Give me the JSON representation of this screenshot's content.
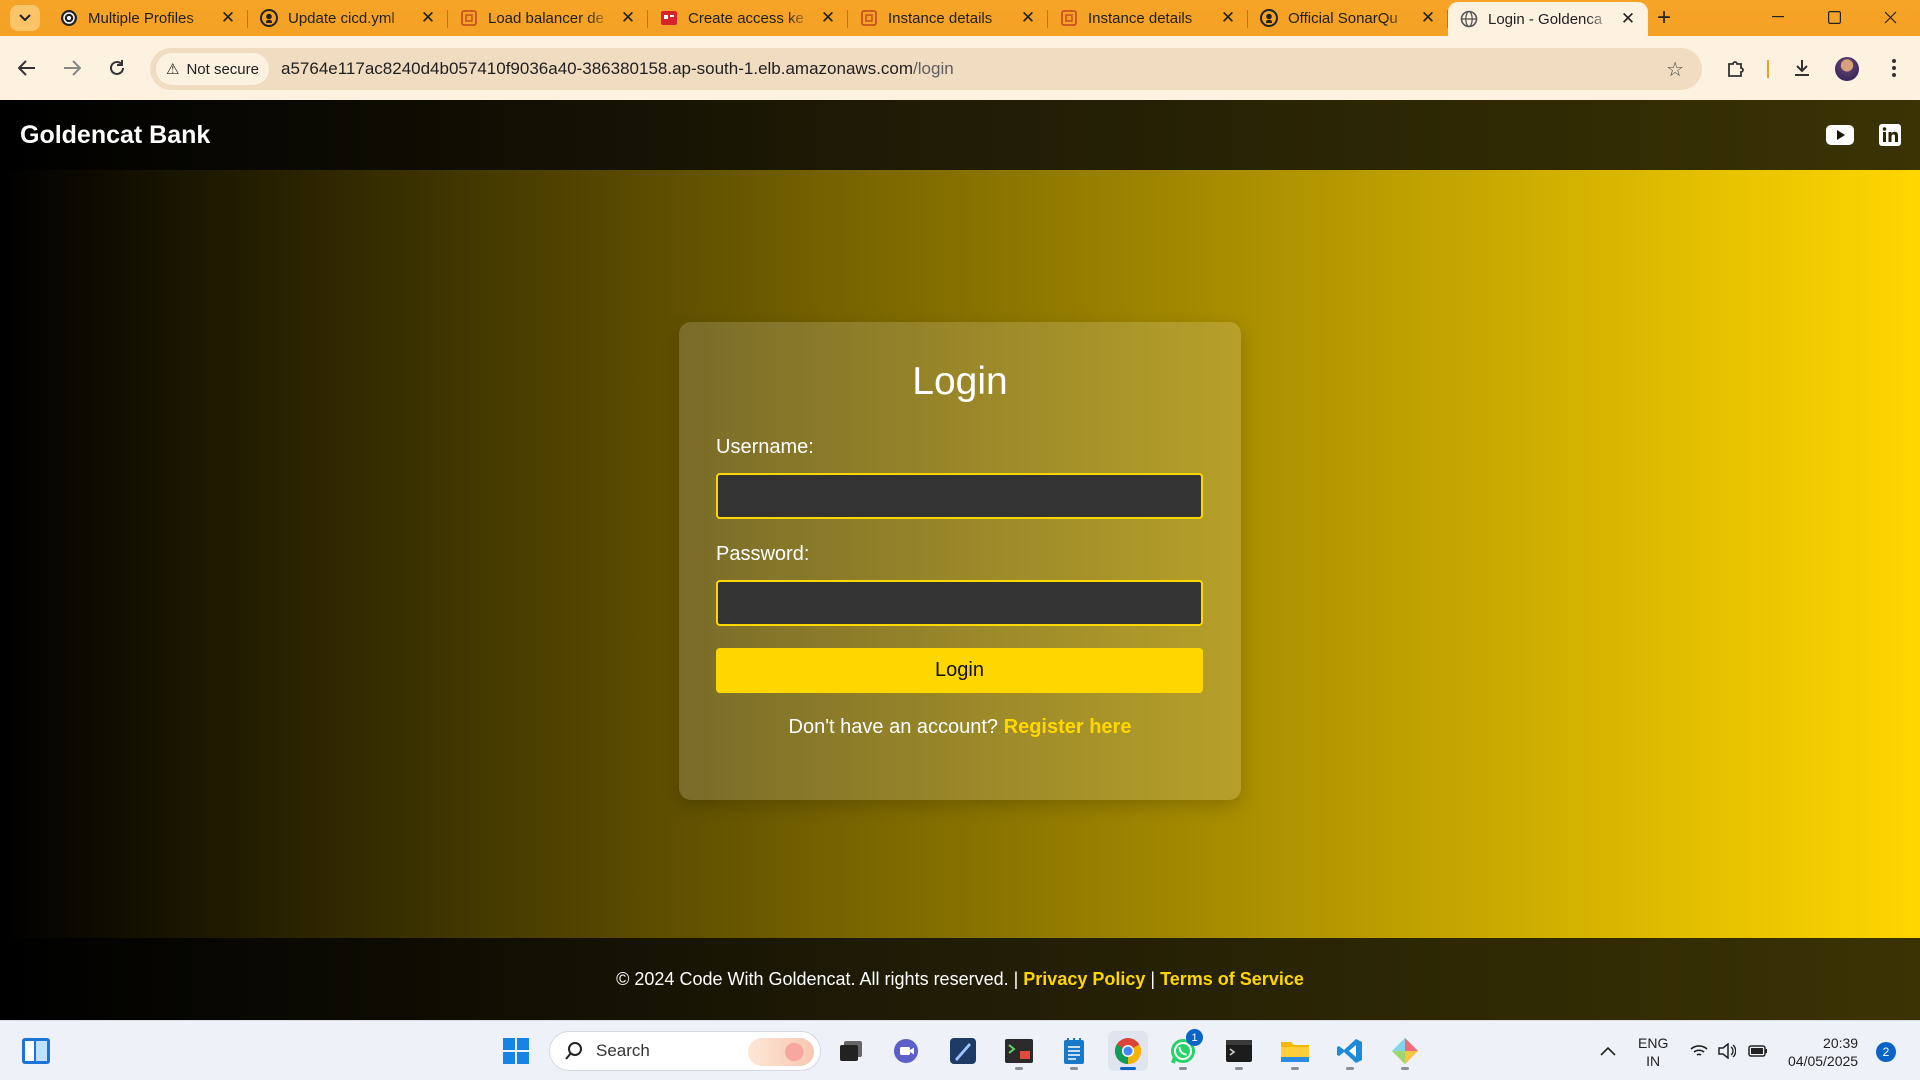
{
  "browser": {
    "tabs": [
      {
        "title": "Multiple Profiles",
        "icon": "profiles-icon"
      },
      {
        "title": "Update cicd.yml",
        "icon": "github-icon"
      },
      {
        "title": "Load balancer de",
        "icon": "aws-ec2-icon"
      },
      {
        "title": "Create access ke",
        "icon": "aws-iam-icon"
      },
      {
        "title": "Instance details",
        "icon": "aws-ec2-icon"
      },
      {
        "title": "Instance details",
        "icon": "aws-ec2-icon"
      },
      {
        "title": "Official SonarQu",
        "icon": "github-icon"
      },
      {
        "title": "Login - Goldenca",
        "icon": "globe-icon",
        "active": true
      }
    ],
    "security_chip": "Not secure",
    "url_host": "a5764e117ac8240d4b057410f9036a40-386380158.ap-south-1.elb.amazonaws.com",
    "url_path": "/login",
    "accent_color": "#f5a623"
  },
  "site": {
    "brand": "Goldencat Bank",
    "social": [
      "youtube-icon",
      "linkedin-icon"
    ],
    "login": {
      "title": "Login",
      "username_label": "Username:",
      "username_value": "",
      "password_label": "Password:",
      "password_value": "",
      "submit_label": "Login",
      "register_prompt": "Don't have an account?",
      "register_link": "Register here"
    },
    "footer": {
      "copyright": "© 2024 Code With Goldencat. All rights reserved. |",
      "privacy": "Privacy Policy",
      "separator": "|",
      "terms": "Terms of Service"
    },
    "colors": {
      "gold": "#ffd700",
      "field_bg": "#333333"
    }
  },
  "taskbar": {
    "search_placeholder": "Search",
    "whatsapp_badge": "1",
    "lang_line1": "ENG",
    "lang_line2": "IN",
    "time": "20:39",
    "date": "04/05/2025",
    "notifications": "2"
  }
}
